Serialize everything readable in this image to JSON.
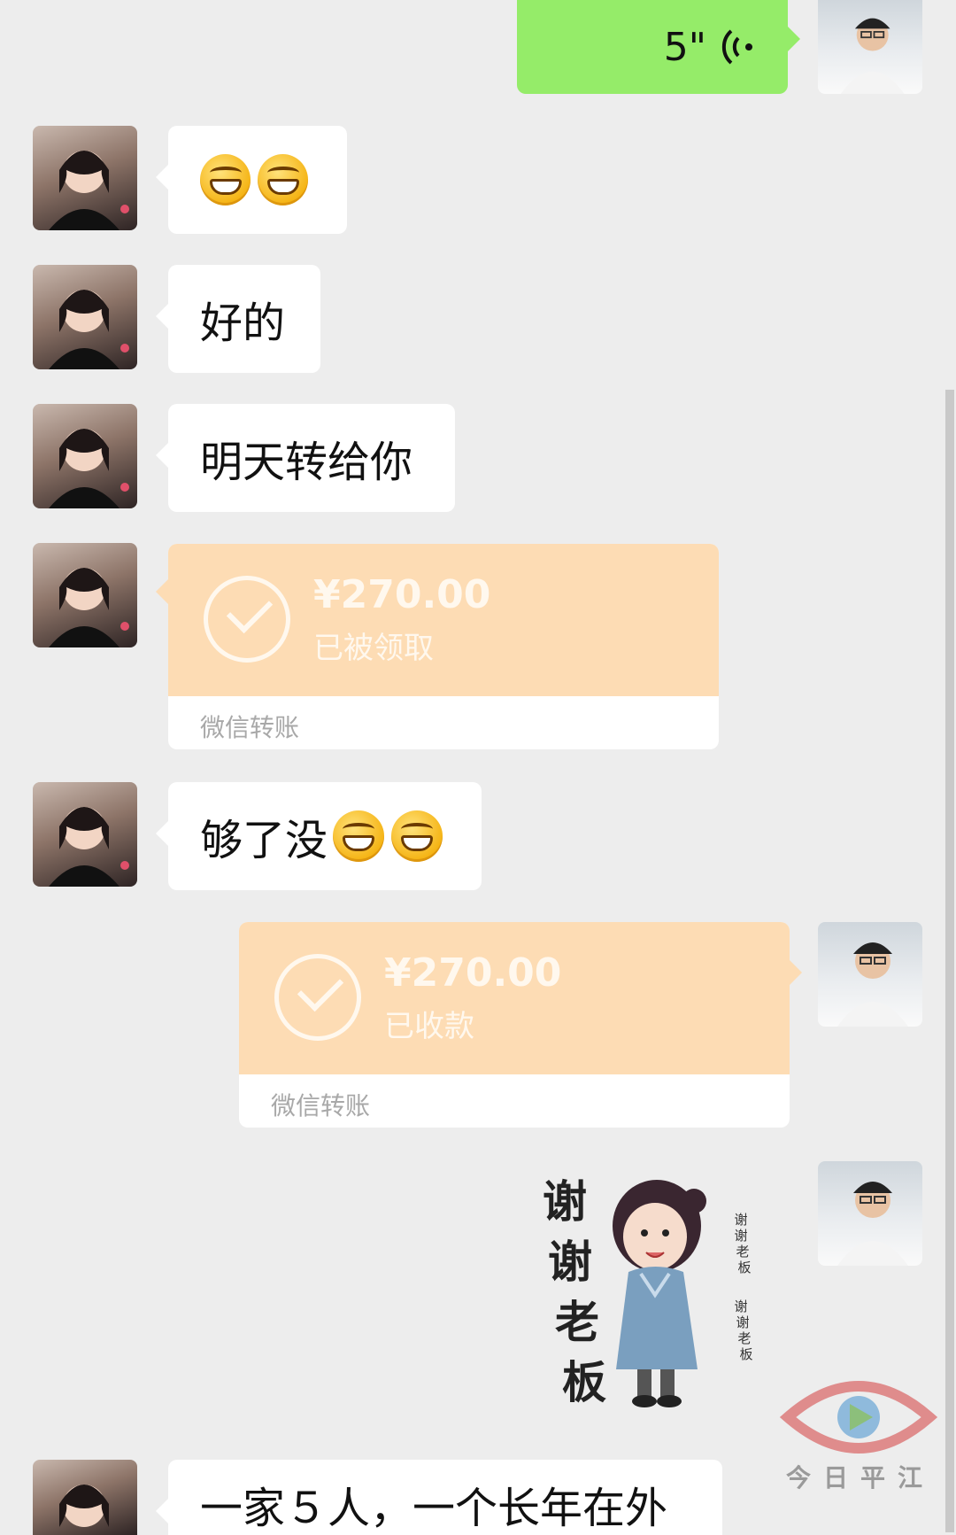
{
  "messages": {
    "voice": {
      "duration": "5\""
    },
    "emoji_msg": {
      "emoji_count": 2
    },
    "text1": "好的",
    "text2": "明天转给你",
    "transfer_received": {
      "amount": "¥270.00",
      "status": "已被领取",
      "footer": "微信转账"
    },
    "text3": "够了没",
    "transfer_collected": {
      "amount": "¥270.00",
      "status": "已收款",
      "footer": "微信转账"
    },
    "sticker": {
      "big_text": [
        "谢",
        "谢",
        "老",
        "板"
      ],
      "side_text_1": [
        "谢",
        "谢",
        "老",
        "板"
      ],
      "side_text_2": [
        "谢",
        "谢",
        "老",
        "板"
      ]
    },
    "text4": "一家５人，一个长年在外"
  },
  "watermark": {
    "text": "今日平江"
  },
  "colors": {
    "background": "#ededed",
    "outgoing_bubble": "#95ec69",
    "incoming_bubble": "#ffffff",
    "transfer_card": "#fddcb4"
  }
}
